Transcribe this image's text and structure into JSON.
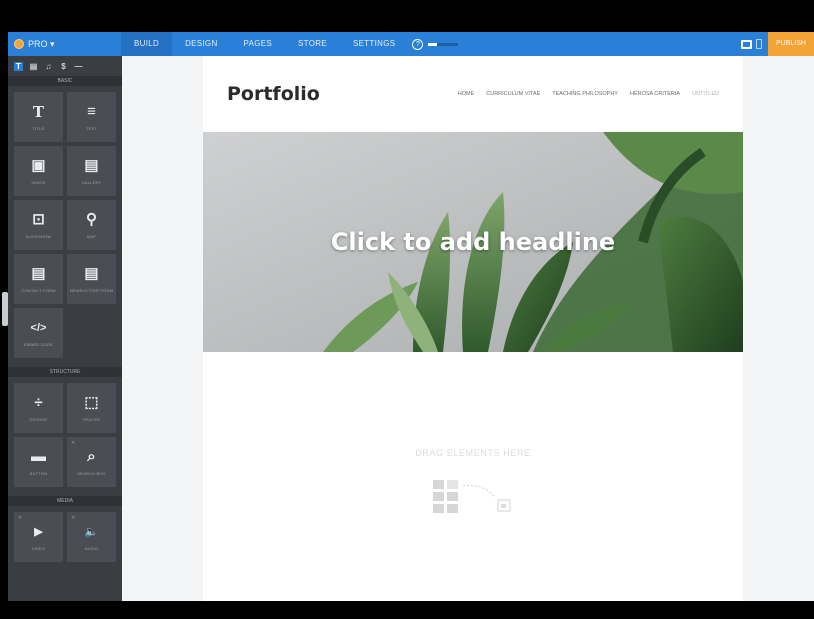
{
  "topbar": {
    "brand": "PRO ▾",
    "nav": [
      "BUILD",
      "DESIGN",
      "PAGES",
      "STORE",
      "SETTINGS"
    ],
    "help_glyph": "?",
    "progress": 0.3,
    "publish": "PUBLISH",
    "colors": {
      "bar": "#2a7fd6",
      "publish": "#f3a236"
    }
  },
  "sidebar": {
    "tools": [
      "T",
      "▤",
      "♫",
      "$",
      "—"
    ],
    "sections": [
      {
        "label": "BASIC",
        "widgets": [
          {
            "glyph": "T",
            "label": "TITLE",
            "icon": "title-icon"
          },
          {
            "glyph": "≡",
            "label": "TEXT",
            "icon": "text-icon"
          },
          {
            "glyph": "▣",
            "label": "IMAGE",
            "icon": "image-icon"
          },
          {
            "glyph": "▤",
            "label": "GALLERY",
            "icon": "gallery-icon"
          },
          {
            "glyph": "⊡",
            "label": "SLIDESHOW",
            "icon": "slideshow-icon"
          },
          {
            "glyph": "⚲",
            "label": "MAP",
            "icon": "map-icon"
          },
          {
            "glyph": "▤",
            "label": "CONTACT FORM",
            "icon": "contact-form-icon"
          },
          {
            "glyph": "▤",
            "label": "NEWSLETTER FORM",
            "icon": "newsletter-form-icon"
          },
          {
            "glyph": "</>",
            "label": "EMBED CODE",
            "icon": "embed-code-icon"
          }
        ]
      },
      {
        "label": "STRUCTURE",
        "widgets": [
          {
            "glyph": "÷",
            "label": "DIVIDER",
            "icon": "divider-icon"
          },
          {
            "glyph": "⬚",
            "label": "SPACER",
            "icon": "spacer-icon"
          },
          {
            "glyph": "▬",
            "label": "BUTTON",
            "icon": "button-icon"
          },
          {
            "glyph": "⌕",
            "label": "SEARCH BOX",
            "icon": "search-box-icon"
          }
        ]
      },
      {
        "label": "MEDIA",
        "widgets": [
          {
            "glyph": "▶",
            "label": "VIDEO",
            "icon": "video-icon"
          },
          {
            "glyph": "🔈",
            "label": "AUDIO",
            "icon": "audio-icon"
          }
        ]
      }
    ]
  },
  "page": {
    "title": "Portfolio",
    "nav": [
      "HOME",
      "CURRICULUM VITAE",
      "TEACHING PHILOSOPHY",
      "HEROSA CRITERIA",
      "UNTITLED"
    ],
    "headline": "Click to add headline",
    "drop_label": "DRAG ELEMENTS HERE"
  }
}
